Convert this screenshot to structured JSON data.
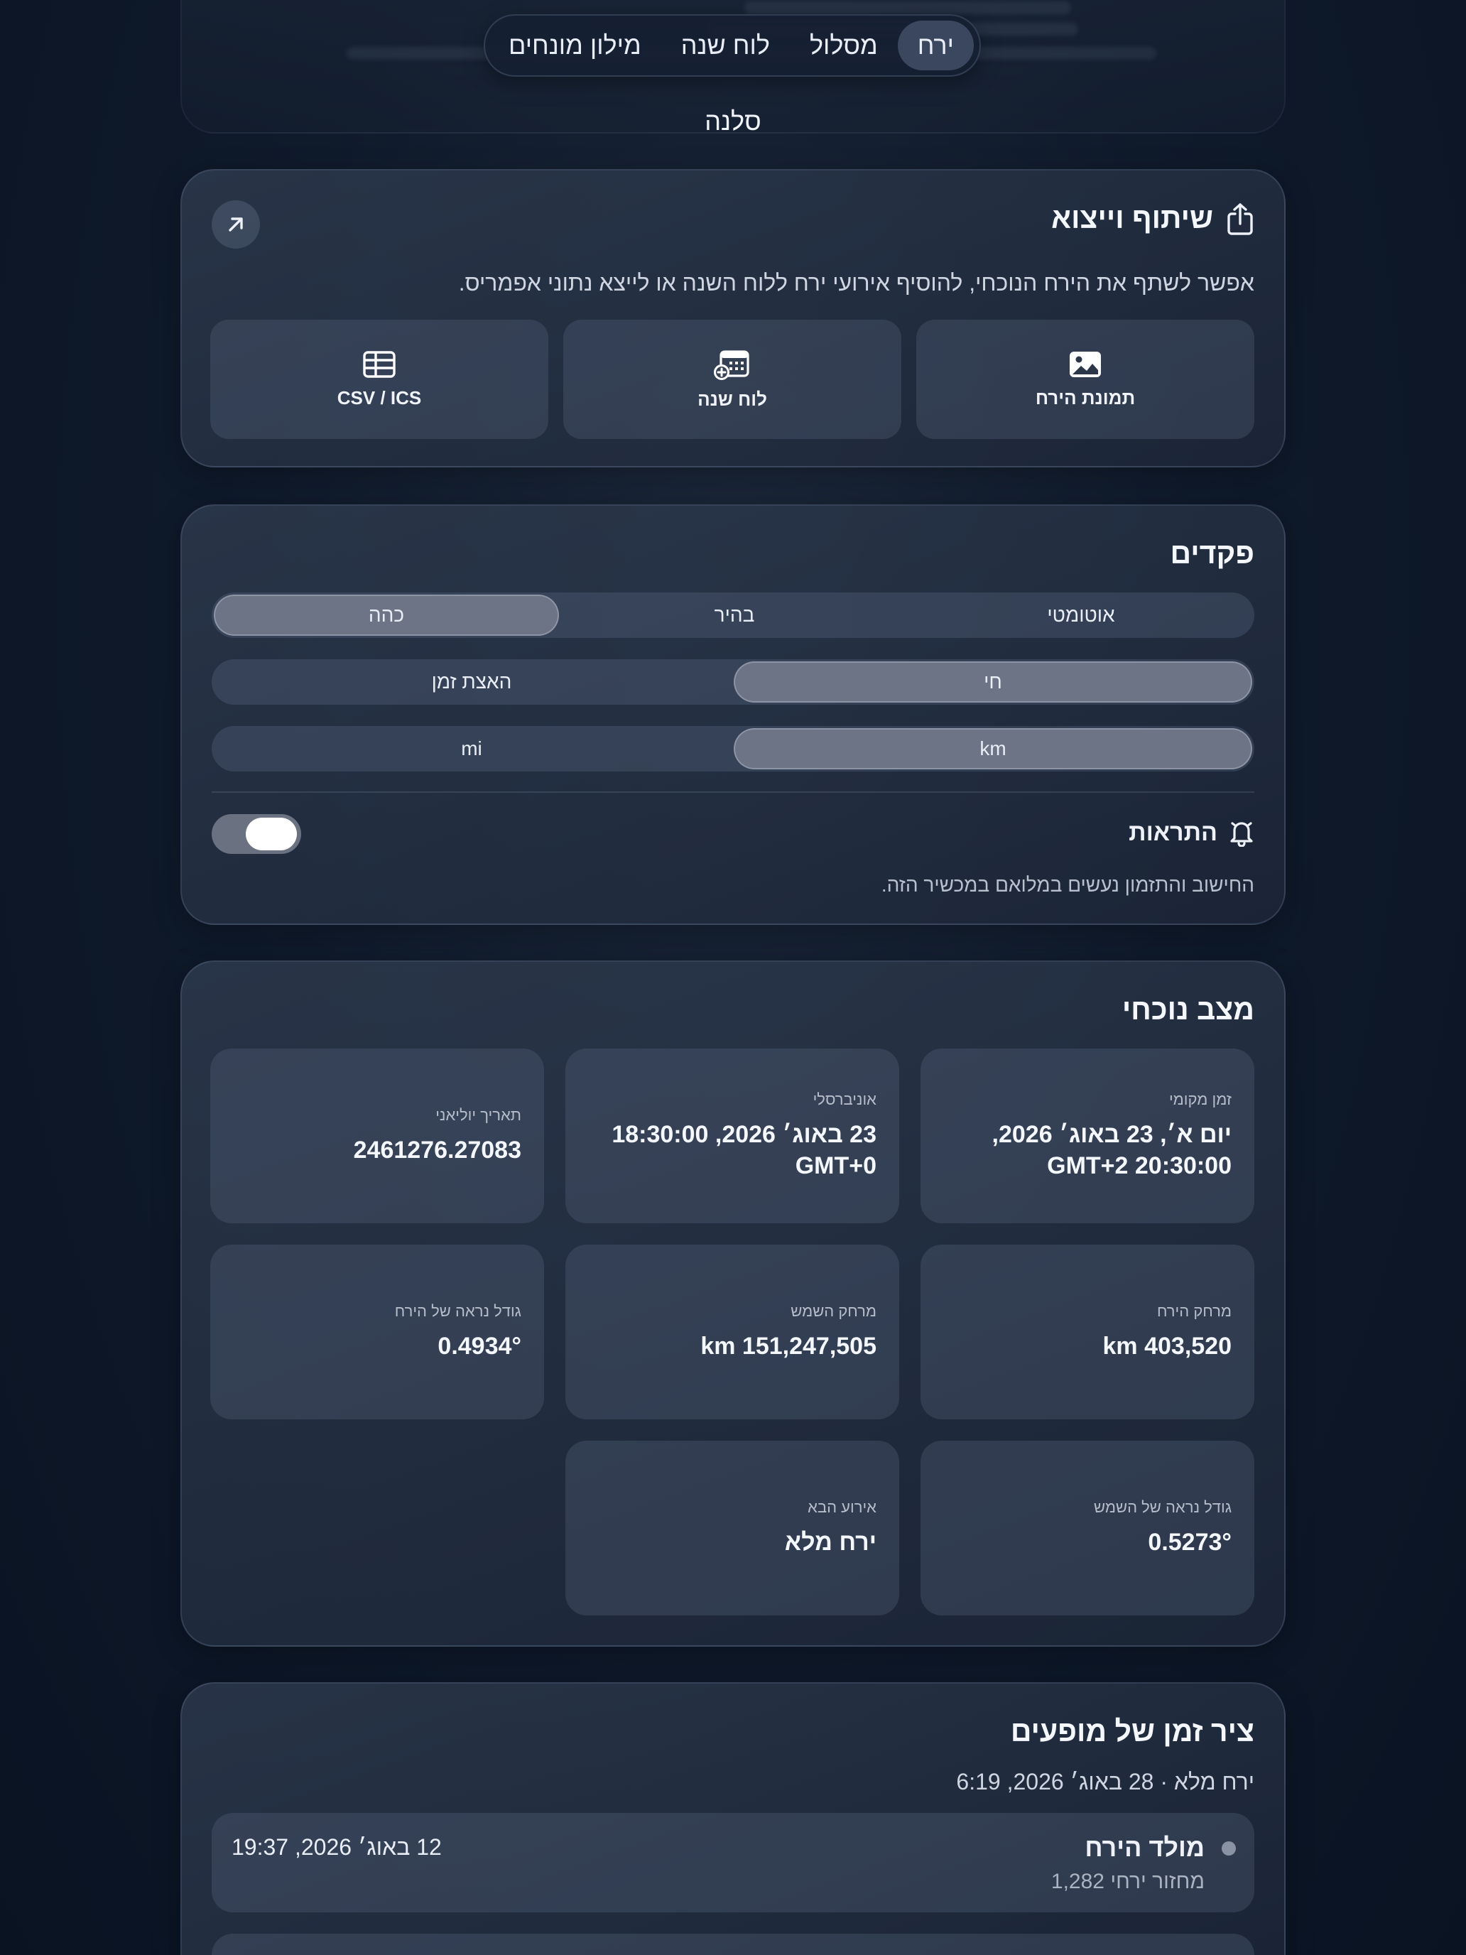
{
  "nav": {
    "tabs": [
      {
        "label": "ירח",
        "active": true
      },
      {
        "label": "מסלול",
        "active": false
      },
      {
        "label": "לוח שנה",
        "active": false
      },
      {
        "label": "מילון מונחים",
        "active": false
      }
    ]
  },
  "app": {
    "title": "סלנה"
  },
  "share": {
    "title": "שיתוף וייצוא",
    "title_icon": "share-icon",
    "expand_icon": "arrow-up-right-icon",
    "description": "אפשר לשתף את הירח הנוכחי, להוסיף אירועי ירח ללוח השנה או לייצא נתוני אפמריס.",
    "tiles": [
      {
        "label": "תמונת הירח",
        "icon": "image-icon"
      },
      {
        "label": "לוח שנה",
        "icon": "calendar-add-icon"
      },
      {
        "label": "CSV / ICS",
        "icon": "table-icon"
      }
    ]
  },
  "settings": {
    "title": "פקדים",
    "theme": {
      "options": [
        "אוטומטי",
        "בהיר",
        "כהה"
      ],
      "selected": "כהה"
    },
    "mode": {
      "options": [
        "חי",
        "האצת זמן"
      ],
      "selected": "חי"
    },
    "units": {
      "options": [
        "km",
        "mi"
      ],
      "selected": "km"
    },
    "notifications": {
      "label": "התראות",
      "icon": "bell-icon",
      "enabled": true
    },
    "footnote": "החישוב והתזמון נעשים במלואם במכשיר הזה."
  },
  "status": {
    "title": "מצב נוכחי",
    "items": [
      {
        "label": "זמן מקומי",
        "value": "יום א׳, 23 באוג׳ 2026, 20:30:00 GMT+2"
      },
      {
        "label": "אוניברסלי",
        "value": "23 באוג׳ 2026, 18:30:00 GMT+0"
      },
      {
        "label": "תאריך יוליאני",
        "value": "2461276.27083"
      },
      {
        "label": "מרחק הירח",
        "value": "403,520 km"
      },
      {
        "label": "מרחק השמש",
        "value": "151,247,505 km"
      },
      {
        "label": "גודל נראה של הירח",
        "value": "0.4934°"
      },
      {
        "label": "גודל נראה של השמש",
        "value": "0.5273°"
      },
      {
        "label": "אירוע הבא",
        "value": "ירח מלא"
      }
    ]
  },
  "timeline": {
    "title": "ציר זמן של מופעים",
    "subtitle": "ירח מלא · 28 באוג׳ 2026, 6:19",
    "rows": [
      {
        "name": "מולד הירח",
        "meta": "מחזור ירחי 1,282",
        "date": "12 באוג׳ 2026, 19:37"
      }
    ]
  }
}
